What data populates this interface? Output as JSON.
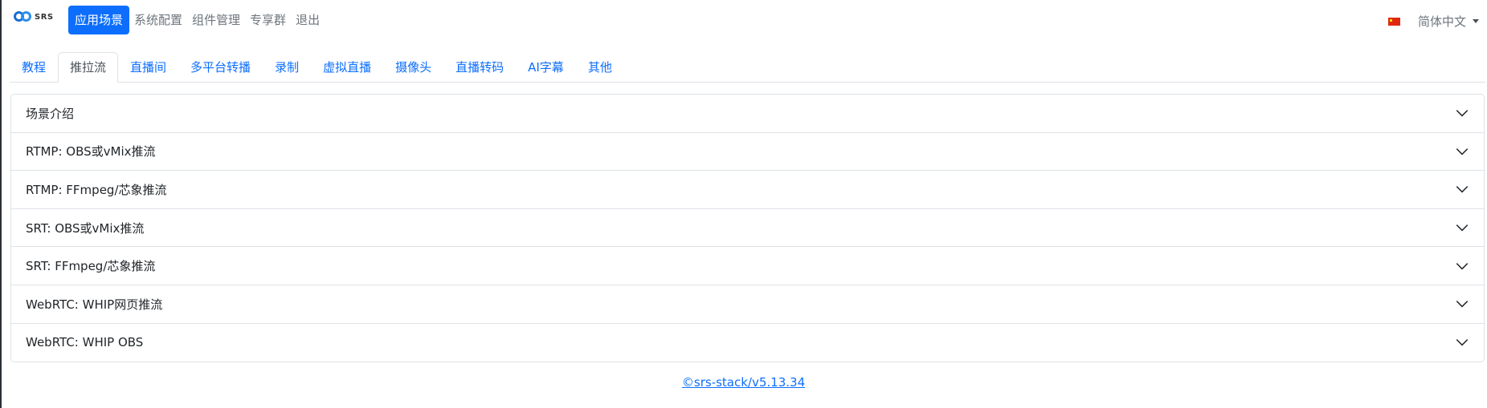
{
  "brand": {
    "logo_text": "SRS"
  },
  "nav": {
    "items": [
      {
        "label": "应用场景",
        "active": true
      },
      {
        "label": "系统配置",
        "active": false
      },
      {
        "label": "组件管理",
        "active": false
      },
      {
        "label": "专享群",
        "active": false
      },
      {
        "label": "退出",
        "active": false
      }
    ]
  },
  "language": {
    "label": "简体中文",
    "flag_icon": "china-flag-icon"
  },
  "tabs": [
    {
      "label": "教程",
      "active": false
    },
    {
      "label": "推拉流",
      "active": true
    },
    {
      "label": "直播间",
      "active": false
    },
    {
      "label": "多平台转播",
      "active": false
    },
    {
      "label": "录制",
      "active": false
    },
    {
      "label": "虚拟直播",
      "active": false
    },
    {
      "label": "摄像头",
      "active": false
    },
    {
      "label": "直播转码",
      "active": false
    },
    {
      "label": "AI字幕",
      "active": false
    },
    {
      "label": "其他",
      "active": false
    }
  ],
  "accordion": {
    "items": [
      {
        "title": "场景介绍",
        "expanded": false
      },
      {
        "title": "RTMP: OBS或vMix推流",
        "expanded": false
      },
      {
        "title": "RTMP: FFmpeg/芯象推流",
        "expanded": false
      },
      {
        "title": "SRT: OBS或vMix推流",
        "expanded": false
      },
      {
        "title": "SRT: FFmpeg/芯象推流",
        "expanded": false
      },
      {
        "title": "WebRTC: WHIP网页推流",
        "expanded": false
      },
      {
        "title": "WebRTC: WHIP OBS",
        "expanded": false
      }
    ]
  },
  "footer": {
    "version_link": "©srs-stack/v5.13.34"
  },
  "colors": {
    "accent": "#0d6efd",
    "muted_text": "#6c757d",
    "border": "#dee2e6"
  }
}
